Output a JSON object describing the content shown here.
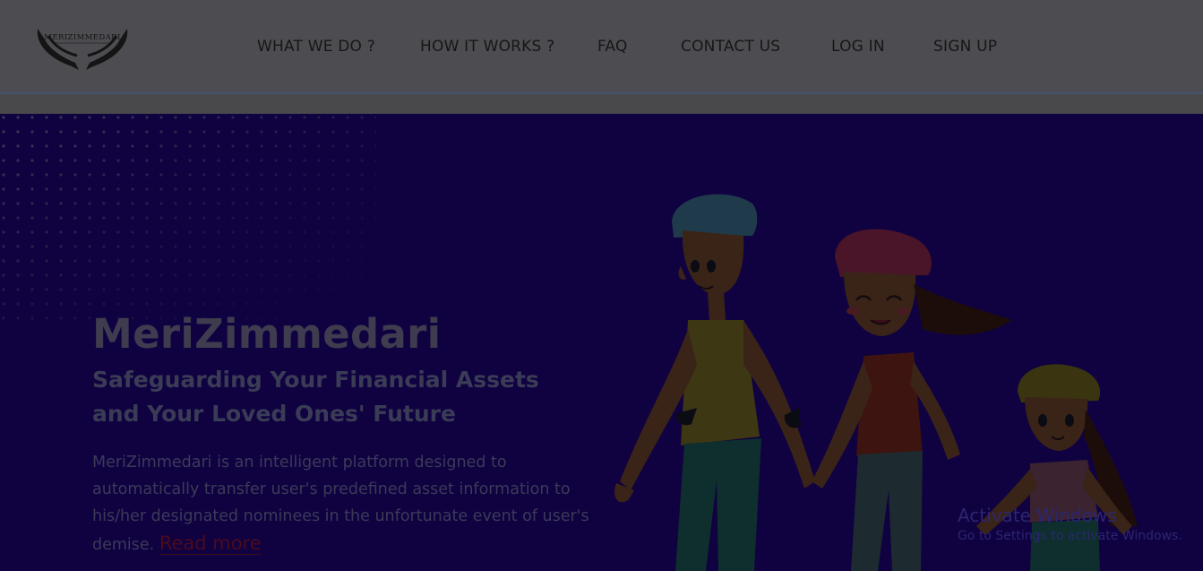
{
  "brand": {
    "logo_text": "MERIZIMMEDARI"
  },
  "nav": {
    "items": [
      {
        "label": "WHAT WE DO ?"
      },
      {
        "label": "HOW IT WORKS ?"
      },
      {
        "label": "FAQ"
      },
      {
        "label": "CONTACT US"
      },
      {
        "label": "LOG IN"
      },
      {
        "label": "SIGN UP"
      }
    ]
  },
  "hero": {
    "title": "MeriZimmedari",
    "tagline": "Safeguarding Your Financial Assets and Your Loved Ones' Future",
    "description": "MeriZimmedari is an intelligent platform designed to automatically transfer user's predefined asset information to his/her designated nominees in the unfortunate event of user's demise.",
    "read_more": "Read more"
  },
  "watermark": {
    "line1": "Activate Windows",
    "line2": "Go to Settings to activate Windows."
  },
  "colors": {
    "overlay": "#100141",
    "header_bg": "#4d4c51",
    "accent_link": "#4a0b1d"
  },
  "icons": {
    "logo": "caring-hands-logo-icon"
  }
}
